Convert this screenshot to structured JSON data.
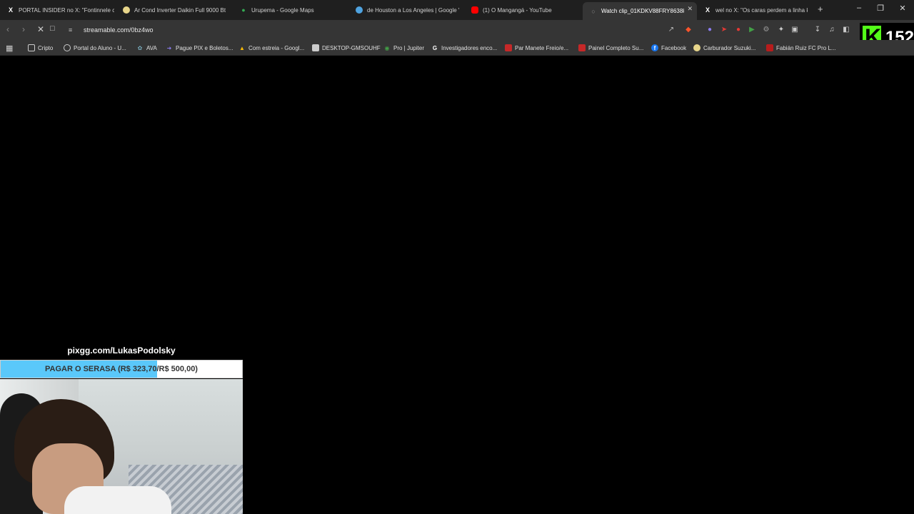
{
  "tabs": [
    {
      "icon": "x-logo-icon",
      "title": "PORTAL INSIDER no X: \"Fontinnele c",
      "active": false
    },
    {
      "icon": "shopping-icon",
      "title": "Ar Cond Inverter Daikin Full 9000 Bt",
      "active": false
    },
    {
      "icon": "maps-pin-icon",
      "title": "Urupema - Google Maps",
      "active": false
    },
    {
      "icon": "travel-icon",
      "title": "de Houston a Los Angeles | Google V",
      "active": false
    },
    {
      "icon": "youtube-icon",
      "title": "(1) O Mangangá - YouTube",
      "active": false
    },
    {
      "icon": "streamable-icon",
      "title": "Watch clip_01KDKV88FRY8638k",
      "active": true
    },
    {
      "icon": "x-logo-icon",
      "title": "wel no X: \"Os caras perdem a linha k",
      "active": false
    }
  ],
  "toolbar": {
    "url": "streamable.com/0bz4wo"
  },
  "bookmarks": [
    {
      "icon": "folder-icon",
      "label": "Cripto"
    },
    {
      "icon": "portal-icon",
      "label": "Portal do Aluno - U..."
    },
    {
      "icon": "ava-icon",
      "label": "AVA"
    },
    {
      "icon": "pix-icon",
      "label": "Pague PIX e Boletos..."
    },
    {
      "icon": "drive-icon",
      "label": "Com estreia - Googl..."
    },
    {
      "icon": "desktop-icon",
      "label": "DESKTOP-GMSOUHF"
    },
    {
      "icon": "jupiter-icon",
      "label": "Pro | Jupiter"
    },
    {
      "icon": "google-icon",
      "label": "Investigadores enco..."
    },
    {
      "icon": "bookmark-red-icon",
      "label": "Par Manete Freio/e..."
    },
    {
      "icon": "bookmark-red-icon",
      "label": "Painel Completo Su..."
    },
    {
      "icon": "facebook-icon",
      "label": "Facebook"
    },
    {
      "icon": "shopping-icon",
      "label": "Carburador Suzuki..."
    },
    {
      "icon": "fc-icon",
      "label": "Fabián Ruiz FC Pro L..."
    }
  ],
  "overlay": {
    "kick_count": "152",
    "pix_link": "pixgg.com/LukasPodolsky",
    "goal_text": "PAGAR O SERASA (R$ 323,70/R$ 500,00)",
    "goal_progress": 0.6474
  },
  "colors": {
    "goal_fill": "#5ac8fa",
    "kick_green": "#53fc18"
  }
}
